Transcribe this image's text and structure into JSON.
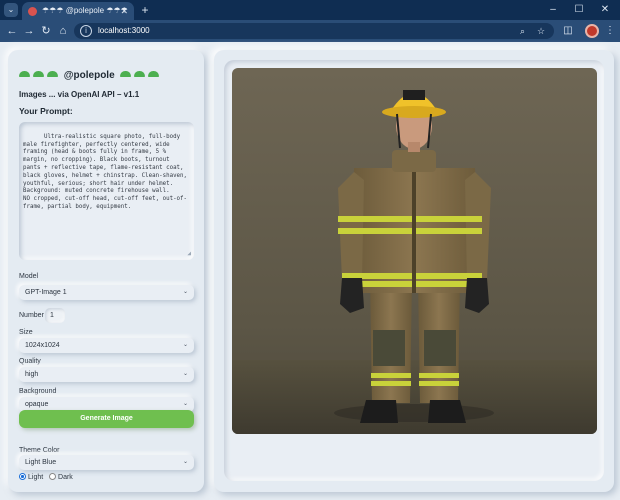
{
  "browser": {
    "tab_title": "☂☂☂ @polepole ☂☂☂",
    "tab_list_icon": "chevron-down-icon",
    "new_tab_icon": "plus-icon",
    "url": "localhost:3000",
    "window_controls": [
      "minimize-icon",
      "maximize-icon",
      "close-icon"
    ],
    "profile_color": "#c0392b"
  },
  "app": {
    "brand": "@polepole",
    "subtitle": "Images ... via OpenAI API – v1.1",
    "prompt_label": "Your Prompt:",
    "prompt_text": "Ultra-realistic square photo, full-body male firefighter, perfectly centered, wide framing (head & boots fully in frame, 5 % margin, no cropping). Black boots, turnout pants + reflective tape, flame-resistant coat, black gloves, helmet + chinstrap. Clean-shaven, youthful, serious; short hair under helmet. Background: muted concrete firehouse wall.\nNO cropped, cut-off head, cut-off feet, out-of-frame, partial body, equipment.",
    "model_label": "Model",
    "model_value": "GPT-Image 1",
    "number_label": "Number",
    "number_value": "1",
    "size_label": "Size",
    "size_value": "1024x1024",
    "quality_label": "Quality",
    "quality_value": "high",
    "background_label": "Background",
    "background_value": "opaque",
    "generate_label": "Generate Image",
    "theme_label": "Theme Color",
    "theme_value": "Light Blue",
    "radio_light": "Light",
    "radio_dark": "Dark",
    "selected_mode": "Light",
    "accent_color": "#6fbf4f",
    "brand_icon_color": "#4caf50"
  }
}
